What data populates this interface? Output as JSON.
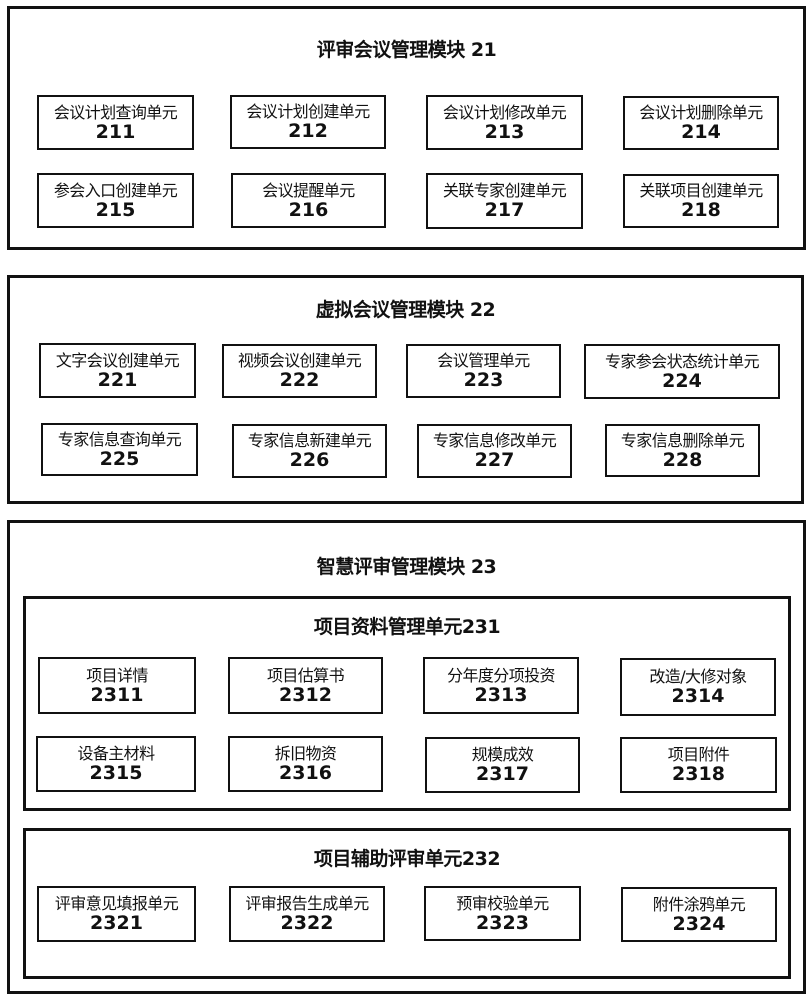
{
  "modules": [
    {
      "title": "评审会议管理模块 21",
      "units": [
        {
          "name": "会议计划查询单元",
          "code": "211"
        },
        {
          "name": "会议计划创建单元",
          "code": "212"
        },
        {
          "name": "会议计划修改单元",
          "code": "213"
        },
        {
          "name": "会议计划删除单元",
          "code": "214"
        },
        {
          "name": "参会入口创建单元",
          "code": "215"
        },
        {
          "name": "会议提醒单元",
          "code": "216"
        },
        {
          "name": "关联专家创建单元",
          "code": "217"
        },
        {
          "name": "关联项目创建单元",
          "code": "218"
        }
      ]
    },
    {
      "title": "虚拟会议管理模块 22",
      "units": [
        {
          "name": "文字会议创建单元",
          "code": "221"
        },
        {
          "name": "视频会议创建单元",
          "code": "222"
        },
        {
          "name": "会议管理单元",
          "code": "223"
        },
        {
          "name": "专家参会状态统计单元",
          "code": "224"
        },
        {
          "name": "专家信息查询单元",
          "code": "225"
        },
        {
          "name": "专家信息新建单元",
          "code": "226"
        },
        {
          "name": "专家信息修改单元",
          "code": "227"
        },
        {
          "name": "专家信息删除单元",
          "code": "228"
        }
      ]
    },
    {
      "title": "智慧评审管理模块 23",
      "groups": [
        {
          "title": "项目资料管理单元231",
          "units": [
            {
              "name": "项目详情",
              "code": "2311"
            },
            {
              "name": "项目估算书",
              "code": "2312"
            },
            {
              "name": "分年度分项投资",
              "code": "2313"
            },
            {
              "name": "改造/大修对象",
              "code": "2314"
            },
            {
              "name": "设备主材料",
              "code": "2315"
            },
            {
              "name": "拆旧物资",
              "code": "2316"
            },
            {
              "name": "规模成效",
              "code": "2317"
            },
            {
              "name": "项目附件",
              "code": "2318"
            }
          ]
        },
        {
          "title": "项目辅助评审单元232",
          "units": [
            {
              "name": "评审意见填报单元",
              "code": "2321"
            },
            {
              "name": "评审报告生成单元",
              "code": "2322"
            },
            {
              "name": "预审校验单元",
              "code": "2323"
            },
            {
              "name": "附件涂鸦单元",
              "code": "2324"
            }
          ]
        }
      ]
    }
  ]
}
